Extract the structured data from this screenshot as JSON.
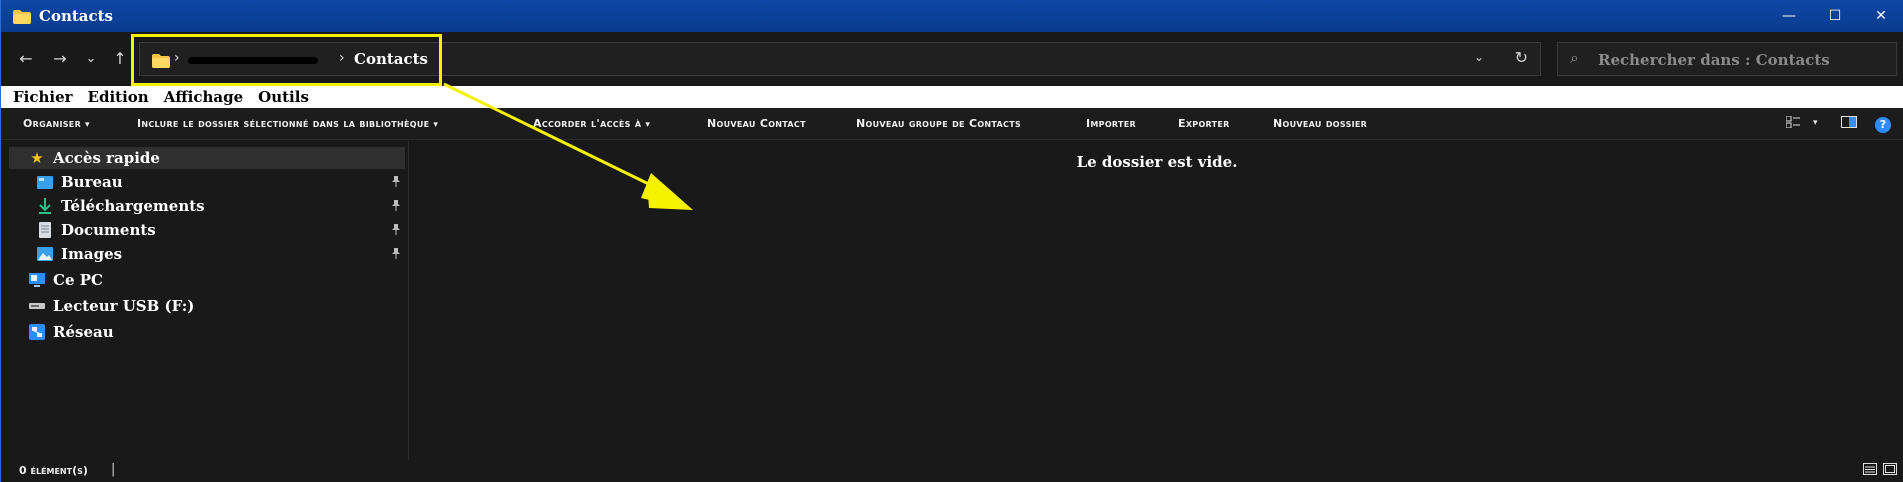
{
  "window": {
    "title": "Contacts",
    "controls": {
      "minimize": "—",
      "maximize": "☐",
      "close": "✕"
    }
  },
  "nav": {
    "back": "←",
    "forward": "→",
    "recent": "⌄",
    "up": "↑"
  },
  "address": {
    "separator1": "›",
    "separator2": "›",
    "current": "Contacts",
    "dropdown": "⌄",
    "refresh": "↻"
  },
  "search": {
    "placeholder": "Rechercher dans : Contacts",
    "icon": "⌕"
  },
  "menubar": {
    "items": [
      "Fichier",
      "Edition",
      "Affichage",
      "Outils"
    ]
  },
  "commands": {
    "organize": "Organiser",
    "include": "Inclure le dossier sélectionné dans la bibliothèque",
    "share": "Accorder l'accès à",
    "new_contact": "Nouveau Contact",
    "new_group": "Nouveau groupe de Contacts",
    "import": "Importer",
    "export": "Exporter",
    "new_folder": "Nouveau dossier",
    "caret": "▾",
    "help": "?"
  },
  "sidebar": {
    "quick_access": "Accès rapide",
    "pinned": [
      {
        "label": "Bureau",
        "icon": "desktop-icon"
      },
      {
        "label": "Téléchargements",
        "icon": "download-icon"
      },
      {
        "label": "Documents",
        "icon": "document-icon"
      },
      {
        "label": "Images",
        "icon": "image-icon"
      }
    ],
    "this_pc": "Ce PC",
    "usb": "Lecteur USB (F:)",
    "network": "Réseau",
    "pin_glyph": "📌"
  },
  "content": {
    "empty_message": "Le dossier est vide."
  },
  "status": {
    "count": "0 élément(s)",
    "separator": "|"
  },
  "colors": {
    "titlebar": "#0b3b8c",
    "highlight": "#f5f200",
    "background": "#191919",
    "accent": "#2f8cff"
  }
}
